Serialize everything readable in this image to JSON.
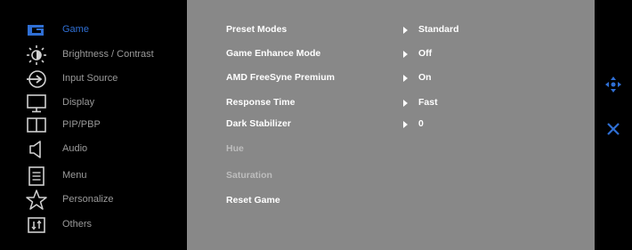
{
  "colors": {
    "accent": "#2f6fd4",
    "sidebar_text": "#9a9a9a",
    "panel_bg": "#888888",
    "value_text": "#ffffff",
    "disabled_text": "#bdbdbd"
  },
  "sidebar": {
    "items": [
      {
        "label": "Game",
        "icon": "game-icon",
        "active": true
      },
      {
        "label": "Brightness / Contrast",
        "icon": "brightness-icon"
      },
      {
        "label": "Input Source",
        "icon": "input-source-icon"
      },
      {
        "label": "Display",
        "icon": "display-icon"
      },
      {
        "label": "PIP/PBP",
        "icon": "pip-pbp-icon"
      },
      {
        "label": "Audio",
        "icon": "speaker-icon"
      },
      {
        "label": "Menu",
        "icon": "menu-icon"
      },
      {
        "label": "Personalize",
        "icon": "star-icon"
      },
      {
        "label": "Others",
        "icon": "others-icon"
      }
    ]
  },
  "main": {
    "rows": [
      {
        "label": "Preset Modes",
        "value": "Standard",
        "enabled": true
      },
      {
        "label": "Game Enhance Mode",
        "value": "Off",
        "enabled": true
      },
      {
        "label": "AMD FreeSyne Premium",
        "value": "On",
        "enabled": true
      },
      {
        "label": "Response Time",
        "value": "Fast",
        "enabled": true
      },
      {
        "label": "Dark Stabilizer",
        "value": "0",
        "enabled": true
      },
      {
        "label": "Hue",
        "value": "",
        "enabled": false
      },
      {
        "label": "Saturation",
        "value": "",
        "enabled": false
      },
      {
        "label": "Reset Game",
        "value": "",
        "enabled": true
      }
    ]
  },
  "rightbar": {
    "buttons": [
      {
        "icon": "navigate-icon"
      },
      {
        "icon": "close-icon"
      }
    ]
  }
}
